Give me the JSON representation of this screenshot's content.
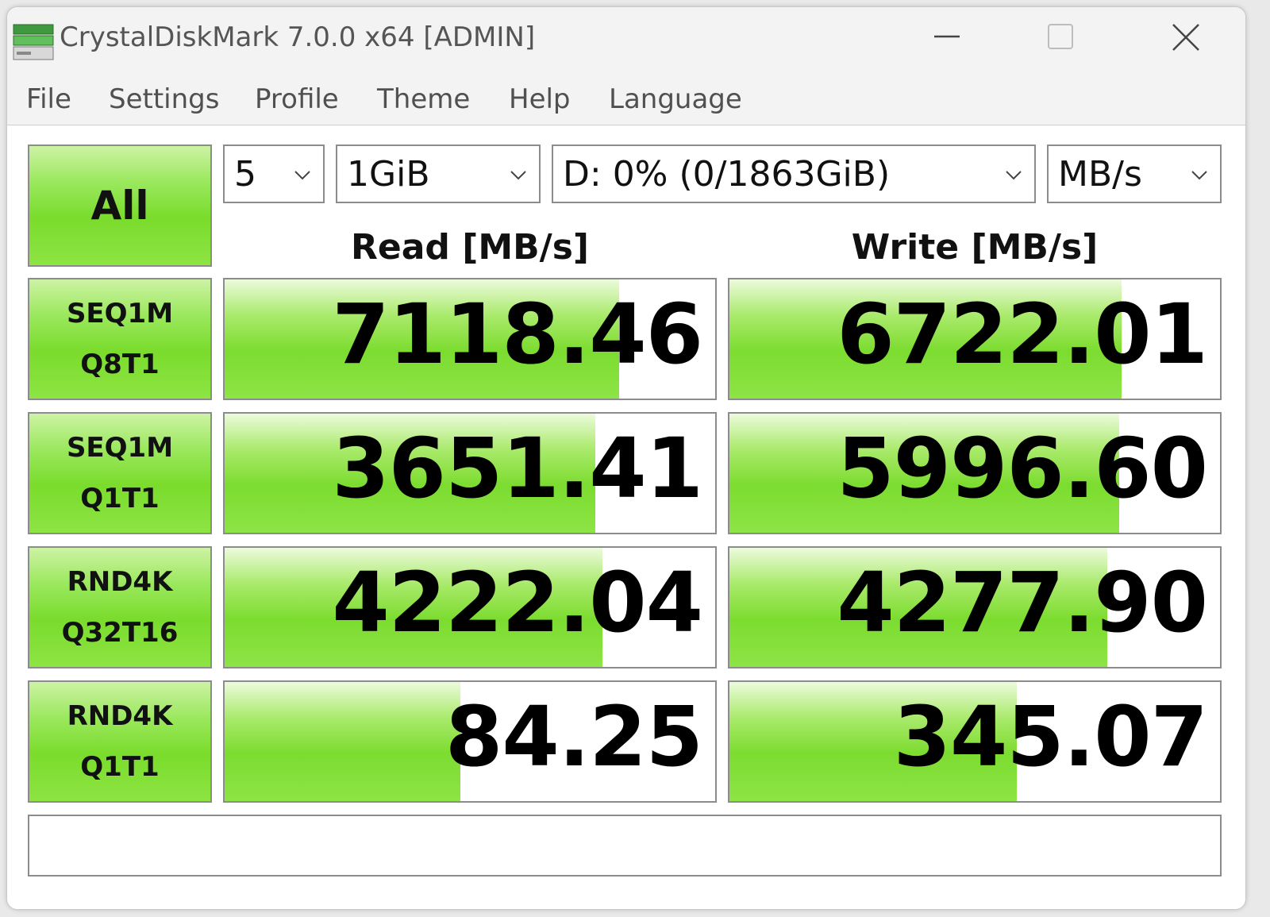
{
  "window": {
    "title": "CrystalDiskMark 7.0.0 x64 [ADMIN]"
  },
  "menu": {
    "items": [
      "File",
      "Settings",
      "Profile",
      "Theme",
      "Help",
      "Language"
    ]
  },
  "controls": {
    "all_label": "All",
    "count": "5",
    "size": "1GiB",
    "drive": "D: 0% (0/1863GiB)",
    "unit": "MB/s"
  },
  "headers": {
    "read": "Read [MB/s]",
    "write": "Write [MB/s]"
  },
  "tests": [
    {
      "line1": "SEQ1M",
      "line2": "Q8T1",
      "read": "7118.46",
      "write": "6722.01",
      "read_fill": 0.805,
      "write_fill": 0.8
    },
    {
      "line1": "SEQ1M",
      "line2": "Q1T1",
      "read": "3651.41",
      "write": "5996.60",
      "read_fill": 0.755,
      "write_fill": 0.795
    },
    {
      "line1": "RND4K",
      "line2": "Q32T16",
      "read": "4222.04",
      "write": "4277.90",
      "read_fill": 0.77,
      "write_fill": 0.77
    },
    {
      "line1": "RND4K",
      "line2": "Q1T1",
      "read": "84.25",
      "write": "345.07",
      "read_fill": 0.48,
      "write_fill": 0.585
    }
  ],
  "status": "",
  "icons": {
    "app": "crystaldiskmark-drive-icon",
    "minimize": "minimize-icon",
    "maximize": "maximize-icon",
    "close": "close-icon",
    "dropdown": "chevron-down-icon"
  },
  "colors": {
    "bar_green": "#7adc2c",
    "border": "#8c8c8c",
    "titlebar": "#f3f3f3"
  }
}
